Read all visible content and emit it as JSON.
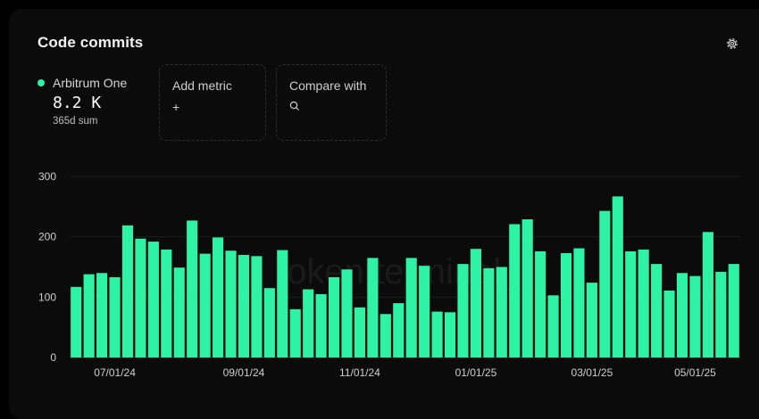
{
  "header": {
    "title": "Code commits",
    "settings_icon": "gear-icon"
  },
  "metric": {
    "name": "Arbitrum One",
    "value": "8.2 K",
    "sub": "365d sum",
    "color": "#2ef2a4"
  },
  "controls": {
    "add_metric_label": "Add metric",
    "add_icon": "plus-icon",
    "compare_label": "Compare with",
    "compare_icon": "search-icon"
  },
  "watermark": "token terminal_",
  "chart_data": {
    "type": "bar",
    "series": [
      {
        "values": [
          117,
          138,
          140,
          133,
          219,
          197,
          192,
          179,
          149,
          227,
          172,
          199,
          177,
          170,
          168,
          115,
          178,
          80,
          113,
          105,
          133,
          146,
          83,
          165,
          72,
          90,
          165,
          152,
          76,
          75,
          155,
          180,
          148,
          150,
          221,
          229,
          176,
          103,
          173,
          181,
          124,
          243,
          267,
          176,
          179,
          155,
          111,
          140,
          135,
          208,
          142,
          155
        ]
      }
    ],
    "color": "#2ef2a4",
    "ylim": [
      0,
      300
    ],
    "yticks": [
      0,
      100,
      200,
      300
    ],
    "xticks": [
      {
        "label": "07/01/24",
        "index": 3
      },
      {
        "label": "09/01/24",
        "index": 13
      },
      {
        "label": "11/01/24",
        "index": 22
      },
      {
        "label": "01/01/25",
        "index": 31
      },
      {
        "label": "03/01/25",
        "index": 40
      },
      {
        "label": "05/01/25",
        "index": 48
      }
    ],
    "grid": true,
    "xlabel": "",
    "ylabel": ""
  }
}
